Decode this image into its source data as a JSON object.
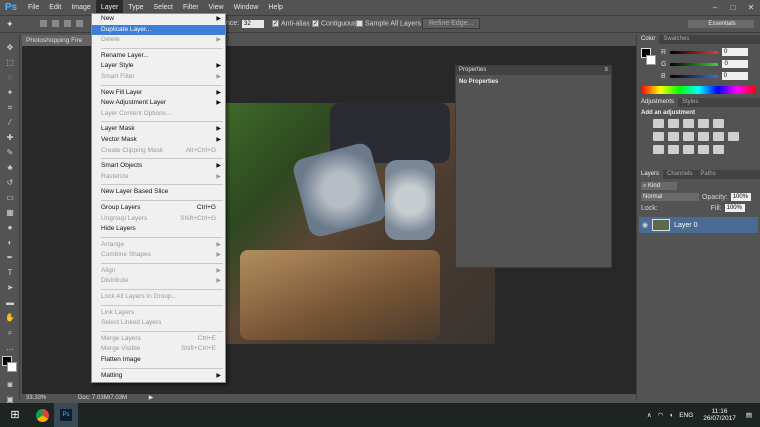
{
  "app": {
    "logo": "Ps"
  },
  "menubar": {
    "items": [
      "File",
      "Edit",
      "Image",
      "Layer",
      "Type",
      "Select",
      "Filter",
      "View",
      "Window",
      "Help"
    ]
  },
  "window_controls": [
    "–",
    "□",
    "✕"
  ],
  "options": {
    "tolerance_label": "nce:",
    "tolerance_value": "32",
    "anti_alias": "Anti-alias",
    "contiguous": "Contiguous",
    "sample_all": "Sample All Layers",
    "refine": "Refine Edge...",
    "workspace": "Essentials"
  },
  "document": {
    "tab_label": "Photoshopping Fire",
    "zoom": "33.33%",
    "doc_size": "Doc: 7.03M/7.03M"
  },
  "properties": {
    "tab_label": "Properties",
    "title": "No Properties"
  },
  "color_panel": {
    "tabs": [
      "Color",
      "Swatches"
    ],
    "channels": [
      {
        "label": "R",
        "value": "0",
        "color": "#e63b3b"
      },
      {
        "label": "G",
        "value": "0",
        "color": "#3bd43b"
      },
      {
        "label": "B",
        "value": "0",
        "color": "#3b6fe6"
      }
    ]
  },
  "adjustments": {
    "tabs": [
      "Adjustments",
      "Styles"
    ],
    "title": "Add an adjustment"
  },
  "layers_panel": {
    "tabs": [
      "Layers",
      "Channels",
      "Paths"
    ],
    "kind": "Kind",
    "blend": "Normal",
    "opacity_label": "Opacity:",
    "opacity": "100%",
    "lock_label": "Lock:",
    "fill_label": "Fill:",
    "fill": "100%",
    "layer_name": "Layer 0"
  },
  "layer_menu": [
    {
      "label": "New",
      "arrow": true
    },
    {
      "label": "Duplicate Layer...",
      "highlight": true
    },
    {
      "label": "Delete",
      "arrow": true,
      "disabled": true
    },
    {
      "sep": true
    },
    {
      "label": "Rename Layer..."
    },
    {
      "label": "Layer Style",
      "arrow": true
    },
    {
      "label": "Smart Filter",
      "arrow": true,
      "disabled": true
    },
    {
      "sep": true
    },
    {
      "label": "New Fill Layer",
      "arrow": true
    },
    {
      "label": "New Adjustment Layer",
      "arrow": true
    },
    {
      "label": "Layer Content Options...",
      "disabled": true
    },
    {
      "sep": true
    },
    {
      "label": "Layer Mask",
      "arrow": true
    },
    {
      "label": "Vector Mask",
      "arrow": true
    },
    {
      "label": "Create Clipping Mask",
      "shortcut": "Alt+Ctrl+G",
      "disabled": true
    },
    {
      "sep": true
    },
    {
      "label": "Smart Objects",
      "arrow": true
    },
    {
      "label": "Rasterize",
      "arrow": true,
      "disabled": true
    },
    {
      "sep": true
    },
    {
      "label": "New Layer Based Slice"
    },
    {
      "sep": true
    },
    {
      "label": "Group Layers",
      "shortcut": "Ctrl+G"
    },
    {
      "label": "Ungroup Layers",
      "shortcut": "Shift+Ctrl+G",
      "disabled": true
    },
    {
      "label": "Hide Layers"
    },
    {
      "sep": true
    },
    {
      "label": "Arrange",
      "arrow": true,
      "disabled": true
    },
    {
      "label": "Combine Shapes",
      "arrow": true,
      "disabled": true
    },
    {
      "sep": true
    },
    {
      "label": "Align",
      "arrow": true,
      "disabled": true
    },
    {
      "label": "Distribute",
      "arrow": true,
      "disabled": true
    },
    {
      "sep": true
    },
    {
      "label": "Lock All Layers in Group...",
      "disabled": true
    },
    {
      "sep": true
    },
    {
      "label": "Link Layers",
      "disabled": true
    },
    {
      "label": "Select Linked Layers",
      "disabled": true
    },
    {
      "sep": true
    },
    {
      "label": "Merge Layers",
      "shortcut": "Ctrl+E",
      "disabled": true
    },
    {
      "label": "Merge Visible",
      "shortcut": "Shift+Ctrl+E",
      "disabled": true
    },
    {
      "label": "Flatten Image"
    },
    {
      "sep": true
    },
    {
      "label": "Matting",
      "arrow": true
    }
  ],
  "taskbar": {
    "start": "⊞",
    "language": "ENG",
    "time": "11:16",
    "date": "26/07/2017"
  }
}
